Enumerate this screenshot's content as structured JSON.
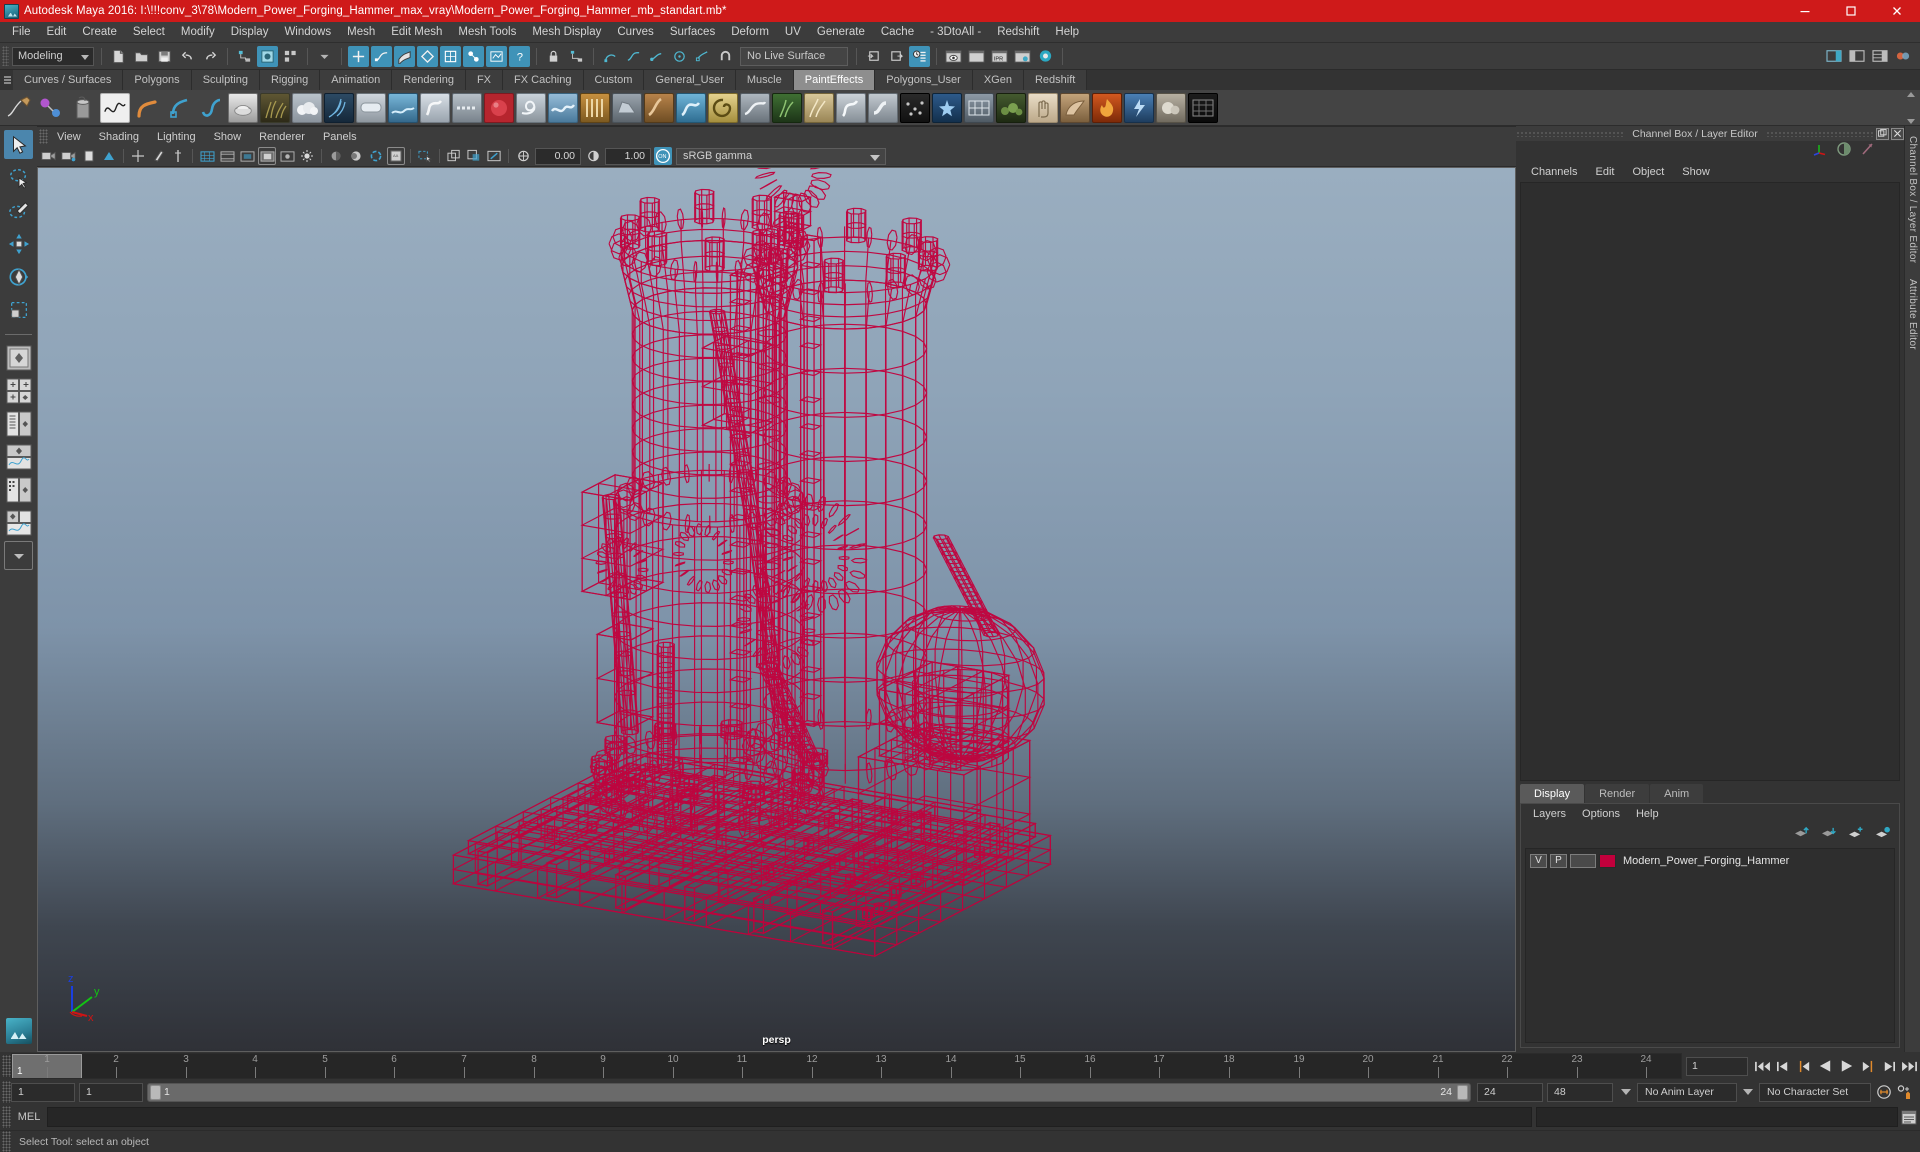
{
  "window": {
    "title": "Autodesk Maya 2016: I:\\!!!conv_3\\78\\Modern_Power_Forging_Hammer_max_vray\\Modern_Power_Forging_Hammer_mb_standart.mb*",
    "minimize": "─",
    "maximize": "☐",
    "close": "✕",
    "titlebar_color": "#cf1a1a"
  },
  "menubar": {
    "items": [
      "File",
      "Edit",
      "Create",
      "Select",
      "Modify",
      "Display",
      "Windows",
      "Mesh",
      "Edit Mesh",
      "Mesh Tools",
      "Mesh Display",
      "Curves",
      "Surfaces",
      "Deform",
      "UV",
      "Generate",
      "Cache",
      "- 3DtoAll -",
      "Redshift",
      "Help"
    ]
  },
  "statusline": {
    "mode": "Modeling",
    "live_surface": "No Live Surface",
    "ipr_label": "IPR"
  },
  "shelf": {
    "tabs": [
      "Curves / Surfaces",
      "Polygons",
      "Sculpting",
      "Rigging",
      "Animation",
      "Rendering",
      "FX",
      "FX Caching",
      "Custom",
      "General_User",
      "Muscle",
      "PaintEffects",
      "Polygons_User",
      "XGen",
      "Redshift"
    ],
    "active_tab": "PaintEffects"
  },
  "viewport": {
    "menus": [
      "View",
      "Shading",
      "Lighting",
      "Show",
      "Renderer",
      "Panels"
    ],
    "exposure": "0.00",
    "gamma": "1.00",
    "color_management": "sRGB gamma",
    "cm_toggle_label": "ON",
    "camera_label": "persp",
    "axis": {
      "x": "x",
      "y": "y",
      "z": "z"
    },
    "wireframe_color": "#c2003c",
    "bg_top": "#9aaec0",
    "bg_bottom": "#2f3137"
  },
  "channelbox": {
    "panel_title": "Channel Box / Layer Editor",
    "menus": [
      "Channels",
      "Edit",
      "Object",
      "Show"
    ],
    "restore_glyph": "❐",
    "close_glyph": "✕",
    "rail_label": "Channel Box / Layer Editor",
    "rail_label2": "Attribute Editor"
  },
  "layer_editor": {
    "tabs": [
      "Display",
      "Render",
      "Anim"
    ],
    "active_tab": "Display",
    "menus": [
      "Layers",
      "Options",
      "Help"
    ],
    "layers": [
      {
        "visibility": "V",
        "playback": "P",
        "shading": "",
        "color": "#c2003c",
        "name": "Modern_Power_Forging_Hammer"
      }
    ]
  },
  "timeline": {
    "ticks": [
      "1",
      "2",
      "3",
      "4",
      "5",
      "6",
      "7",
      "8",
      "9",
      "10",
      "11",
      "12",
      "13",
      "14",
      "15",
      "16",
      "17",
      "18",
      "19",
      "20",
      "21",
      "22",
      "23",
      "24"
    ],
    "current_frame_marker": "1",
    "current_frame_field": "1",
    "range_start": "1",
    "range_start2": "1",
    "range_bar_left": "1",
    "range_bar_right": "24",
    "range_end": "24",
    "playback_end": "48",
    "anim_layer": "No Anim Layer",
    "character_set": "No Character Set"
  },
  "command_line": {
    "language": "MEL",
    "input_value": "",
    "status": "Select Tool: select an object"
  }
}
